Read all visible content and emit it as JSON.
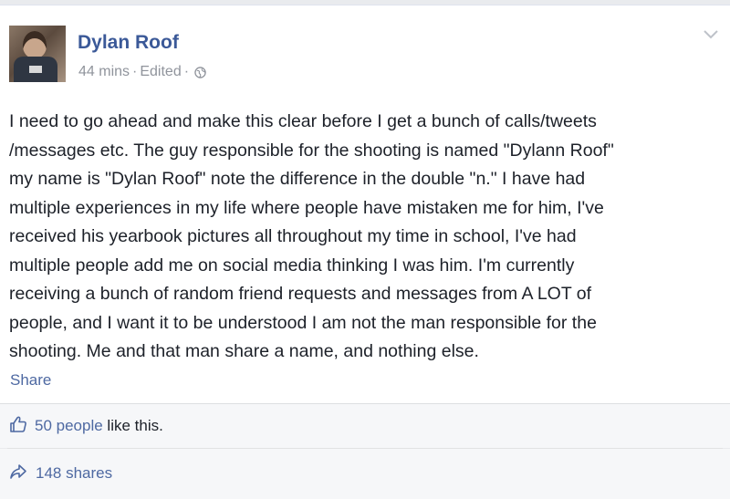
{
  "post": {
    "author": "Dylan Roof",
    "time": "44 mins",
    "dot1": "·",
    "edited": "Edited",
    "dot2": "·",
    "privacy_icon": "globe-icon",
    "options_icon": "chevron-down-icon",
    "body_lines": [
      "I need to go ahead and make this clear before I get a bunch of calls/tweets",
      "/messages etc. The guy responsible for the shooting is named \"Dylann Roof\"",
      "my name is \"Dylan Roof\" note the difference in the double \"n.\" I have had",
      "multiple experiences in my life where people have mistaken me for him, I've",
      "received his yearbook pictures all throughout my time in school, I've had",
      "multiple people add me on social media thinking I was him. I'm currently",
      "receiving a bunch of random friend requests and messages from A LOT of",
      "people, and I want it to be understood I am not the man responsible for the",
      "shooting. Me and that man share a name, and nothing else."
    ],
    "share_label": "Share"
  },
  "footer": {
    "like_icon": "thumbs-up-icon",
    "likes_link": "50 people",
    "likes_suffix": " like this.",
    "share_icon": "share-arrow-icon",
    "shares_label": "148 shares"
  },
  "colors": {
    "link": "#4e69a2",
    "author": "#3b5998",
    "meta": "#90949c",
    "footer_bg": "#f6f7f9"
  }
}
